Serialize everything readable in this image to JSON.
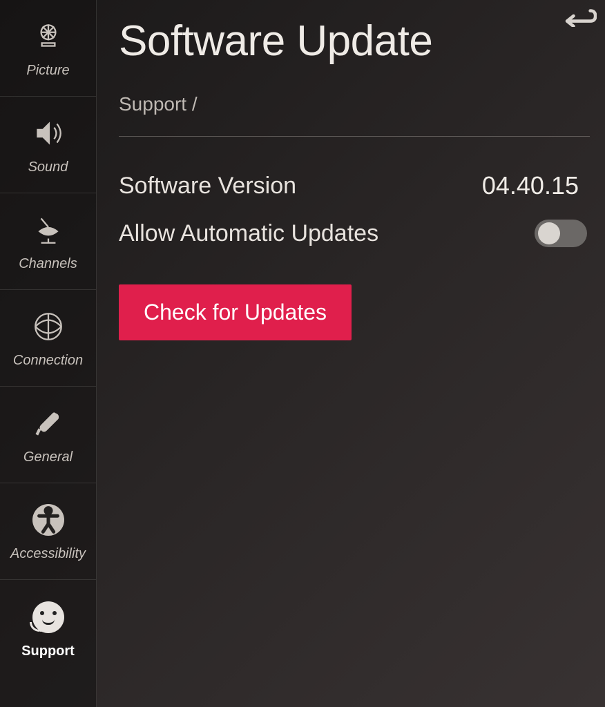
{
  "header": {
    "title": "Software Update",
    "breadcrumb": "Support /"
  },
  "sidebar": {
    "items": [
      {
        "label": "Picture",
        "icon": "picture-icon"
      },
      {
        "label": "Sound",
        "icon": "sound-icon"
      },
      {
        "label": "Channels",
        "icon": "channels-icon"
      },
      {
        "label": "Connection",
        "icon": "connection-icon"
      },
      {
        "label": "General",
        "icon": "general-icon"
      },
      {
        "label": "Accessibility",
        "icon": "accessibility-icon"
      },
      {
        "label": "Support",
        "icon": "support-icon"
      }
    ]
  },
  "main": {
    "version_label": "Software Version",
    "version_value": "04.40.15",
    "auto_label": "Allow Automatic Updates",
    "auto_enabled": false,
    "check_label": "Check for Updates"
  },
  "colors": {
    "accent": "#e01f4c"
  }
}
